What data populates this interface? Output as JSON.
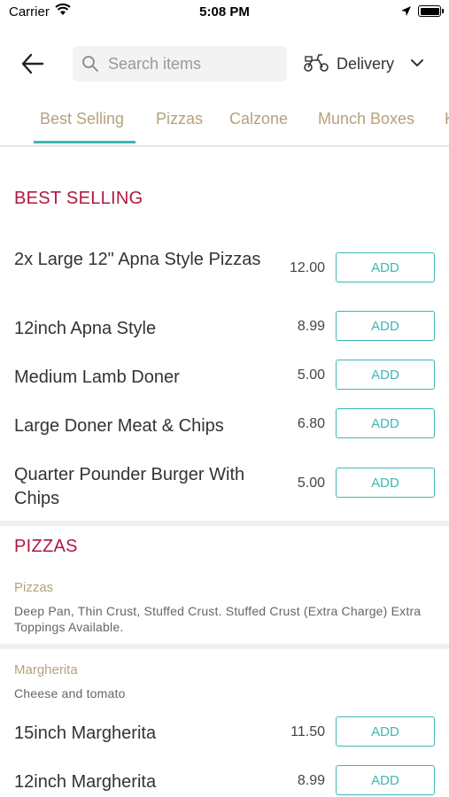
{
  "status_bar": {
    "carrier": "Carrier",
    "time": "5:08 PM"
  },
  "header": {
    "search_placeholder": "Search items",
    "delivery_label": "Delivery"
  },
  "tabs": [
    "Best Selling",
    "Pizzas",
    "Calzone",
    "Munch Boxes",
    "K"
  ],
  "best_selling": {
    "title": "BEST SELLING",
    "items": [
      {
        "name": "2x Large 12\" Apna Style Pizzas",
        "price": "12.00",
        "action": "ADD"
      },
      {
        "name": "12inch Apna Style",
        "price": "8.99",
        "action": "ADD"
      },
      {
        "name": "Medium Lamb Doner",
        "price": "5.00",
        "action": "ADD"
      },
      {
        "name": "Large Doner Meat & Chips",
        "price": "6.80",
        "action": "ADD"
      },
      {
        "name": "Quarter Pounder Burger With Chips",
        "price": "5.00",
        "action": "ADD"
      }
    ]
  },
  "pizzas": {
    "title": "PIZZAS",
    "category_name": "Pizzas",
    "category_desc": "Deep Pan, Thin Crust, Stuffed Crust. Stuffed Crust (Extra Charge) Extra Toppings Available.",
    "sub_name": "Margherita",
    "sub_desc": "Cheese and tomato",
    "items": [
      {
        "name": "15inch Margherita",
        "price": "11.50",
        "action": "ADD"
      },
      {
        "name": "12inch Margherita",
        "price": "8.99",
        "action": "ADD"
      }
    ]
  },
  "colors": {
    "accent": "#3fb6b4",
    "section_title": "#b0183f",
    "tab_text": "#b5a27c"
  }
}
